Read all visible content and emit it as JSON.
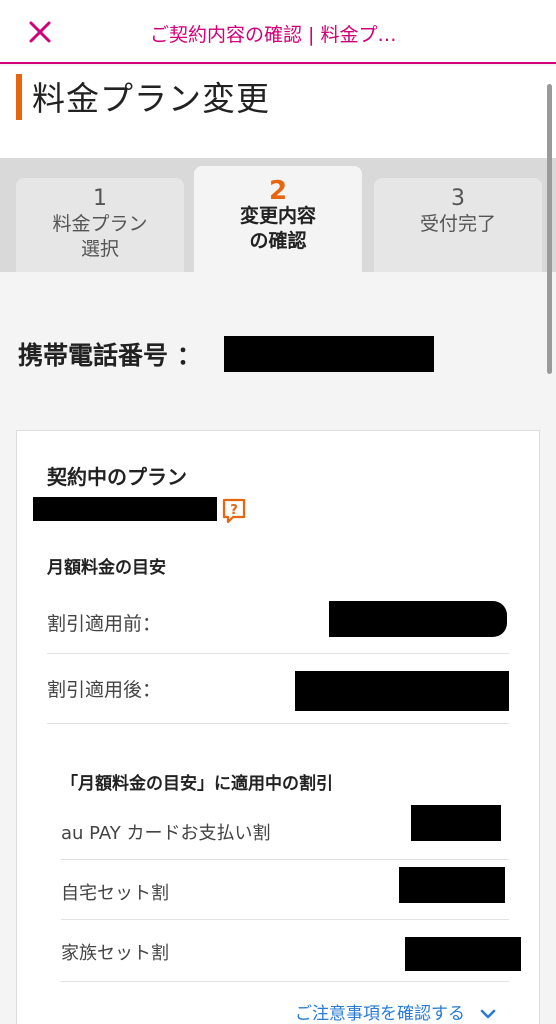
{
  "header": {
    "title": "ご契約内容の確認 | 料金プ…",
    "close_icon": "close-icon",
    "accent_color": "#d1007a"
  },
  "page": {
    "title": "料金プラン変更",
    "accent_color": "#e8650f"
  },
  "steps": [
    {
      "number": "1",
      "label_line1": "料金プラン",
      "label_line2": "選択",
      "active": false
    },
    {
      "number": "2",
      "label_line1": "変更内容",
      "label_line2": "の確認",
      "active": true
    },
    {
      "number": "3",
      "label_line1": "受付完了",
      "label_line2": "",
      "active": false
    }
  ],
  "phone": {
    "label": "携帯電話番号 ："
  },
  "plan_card": {
    "title": "契約中のプラン",
    "help_icon": "question-bubble-icon",
    "monthly_title": "月額料金の目安",
    "before_discount_label": "割引適用前：",
    "after_discount_label": "割引適用後：",
    "discounts_title": "「月額料金の目安」に適用中の割引",
    "discounts": [
      {
        "label": "au PAY カードお支払い割"
      },
      {
        "label": "自宅セット割"
      },
      {
        "label": "家族セット割"
      }
    ],
    "notice_link": "ご注意事項を確認する",
    "link_color": "#2a7bd3"
  }
}
